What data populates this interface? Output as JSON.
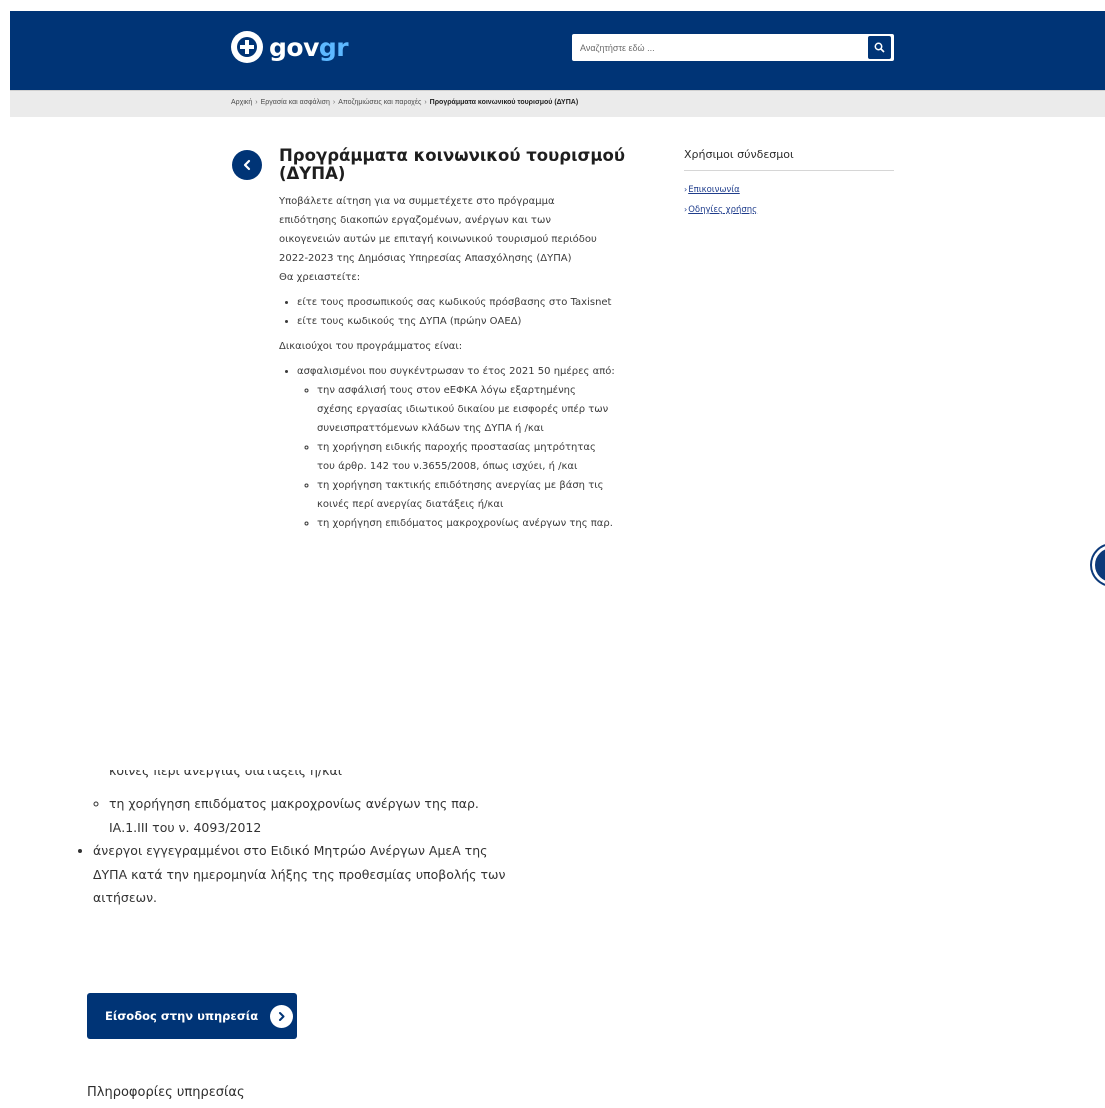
{
  "header": {
    "logo_text_main": "gov",
    "logo_text_accent": "gr",
    "search_placeholder": "Αναζητήστε εδώ ..."
  },
  "breadcrumb": [
    "Αρχική",
    "Εργασία και ασφάλιση",
    "Αποζημιώσεις και παροχές",
    "Προγράμματα κοινωνικού τουρισμού (ΔΥΠΑ)"
  ],
  "page": {
    "title": "Προγράμματα κοινωνικού τουρισμού (ΔΥΠΑ)",
    "intro": "Υποβάλετε αίτηση για να συμμετέχετε στο πρόγραμμα επιδότησης διακοπών εργαζομένων, ανέργων και των οικογενειών αυτών με επιταγή κοινωνικού τουρισμού περιόδου 2022-2023 της Δημόσιας Υπηρεσίας Απασχόλησης (ΔΥΠΑ)",
    "need_label": "Θα χρειαστείτε:",
    "need_items": [
      "είτε τους προσωπικούς σας κωδικούς πρόσβασης στο Taxisnet",
      "είτε τους κωδικούς της ΔΥΠΑ (πρώην ΟΑΕΔ)"
    ],
    "beneficiaries_label": "Δικαιούχοι του προγράμματος είναι:",
    "beneficiary_main": "ασφαλισμένοι που συγκέντρωσαν το έτος 2021 50 ημέρες από:",
    "beneficiary_sub": [
      "την ασφάλισή τους στον eΕΦΚΑ λόγω εξαρτημένης σχέσης εργασίας ιδιωτικού δικαίου με εισφορές υπέρ των συνεισπραττόμενων κλάδων της ΔΥΠΑ ή /και",
      "τη χορήγηση ειδικής παροχής προστασίας μητρότητας του άρθρ. 142 του ν.3655/2008, όπως ισχύει, ή /και",
      "τη χορήγηση τακτικής επιδότησης ανεργίας με βάση τις κοινές περί ανεργίας διατάξεις ή/και",
      "τη χορήγηση επιδόματος μακροχρονίως ανέργων της παρ."
    ]
  },
  "sidebar": {
    "title": "Χρήσιμοι σύνδεσμοι",
    "links": [
      "Επικοινωνία",
      "Οδηγίες χρήσης"
    ]
  },
  "lower": {
    "cut_line": "κοινές περί ανεργίας διατάξεις ή/και",
    "sub_item": "τη χορήγηση επιδόματος μακροχρονίως ανέργων της παρ. ΙΑ.1.ΙΙΙ του ν. 4093/2012",
    "main_item": "άνεργοι εγγεγραμμένοι στο Ειδικό Μητρώο Ανέργων ΑμεΑ της ΔΥΠΑ κατά την ημερομηνία λήξης της προθεσμίας υποβολής των αιτήσεων.",
    "cta_label": "Είσοδος στην υπηρεσία",
    "info_heading": "Πληροφορίες υπηρεσίας"
  }
}
